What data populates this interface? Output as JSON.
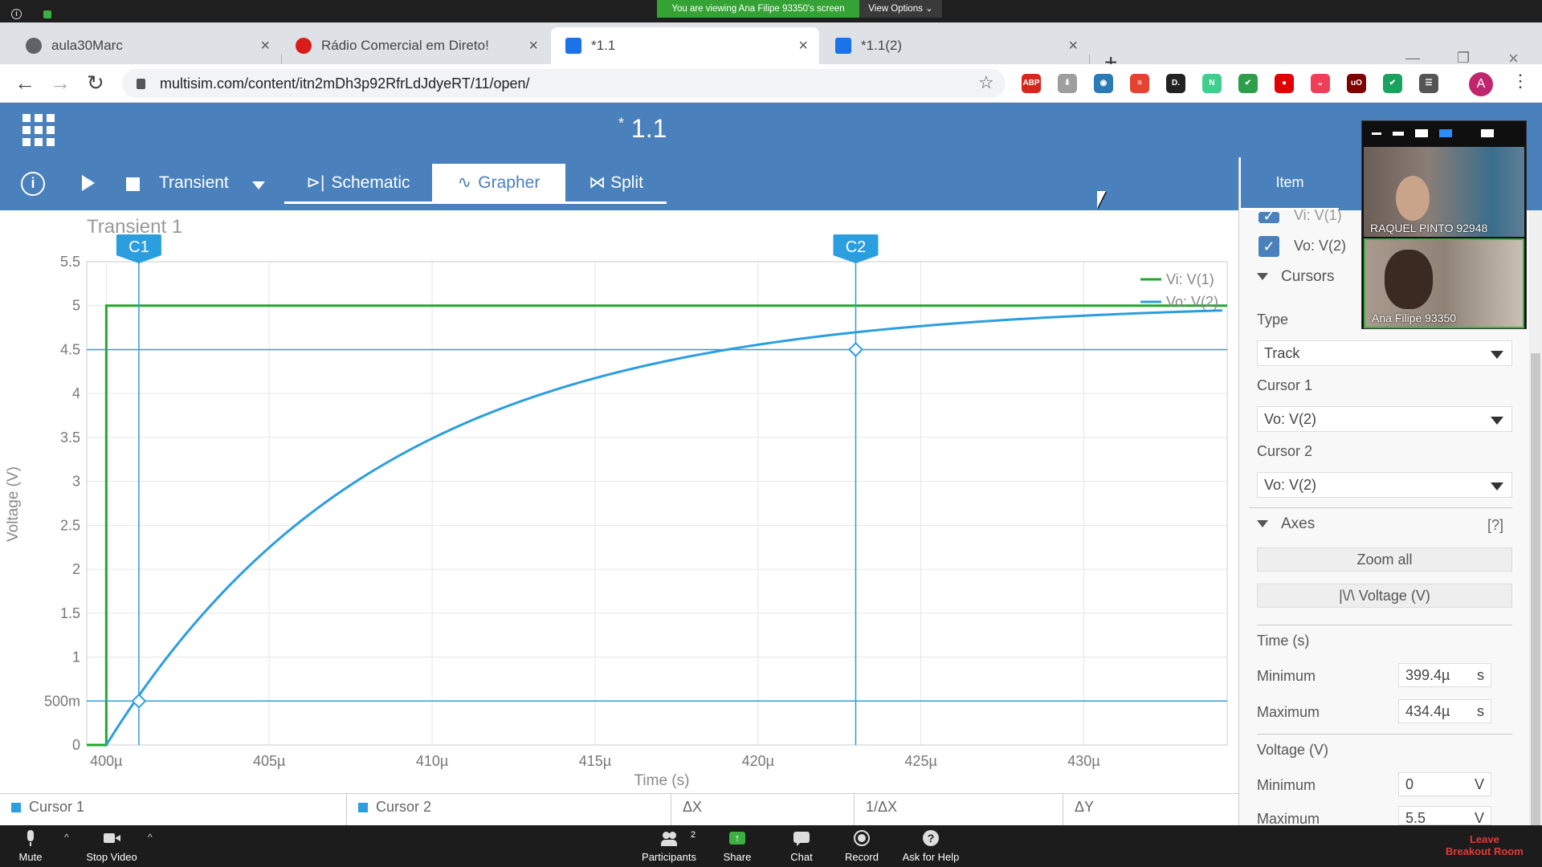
{
  "zoom_banner": {
    "message": "You are viewing Ana Filipe 93350's screen",
    "view_options": "View Options ⌄"
  },
  "browser": {
    "tabs": [
      {
        "title": "aula30Marc",
        "icon_color": "#5f6368"
      },
      {
        "title": "Rádio Comercial em Direto!",
        "icon_color": "#d81b1b"
      },
      {
        "title": "*1.1",
        "icon_color": "#1a73e8"
      },
      {
        "title": "*1.1(2)",
        "icon_color": "#1a73e8"
      }
    ],
    "url": "multisim.com/content/itn2mDh3p92RfrLdJdyeRT/11/open/",
    "profile_initial": "A",
    "extensions": [
      {
        "name": "adblock-plus-icon",
        "label": "ABP",
        "color": "#d7261e"
      },
      {
        "name": "download-icon",
        "label": "⬇",
        "color": "#9e9e9e"
      },
      {
        "name": "eye-extension-icon",
        "label": "◉",
        "color": "#2a7ab8"
      },
      {
        "name": "todoist-icon",
        "label": "≡",
        "color": "#e44332"
      },
      {
        "name": "d-extension-icon",
        "label": "D.",
        "color": "#222222"
      },
      {
        "name": "notion-n-icon",
        "label": "N",
        "color": "#3ecf8e"
      },
      {
        "name": "shield-icon",
        "label": "✔",
        "color": "#2e9e4a"
      },
      {
        "name": "red-extension-icon",
        "label": "●",
        "color": "#e00000"
      },
      {
        "name": "pocket-icon",
        "label": "⌄",
        "color": "#ef3f56"
      },
      {
        "name": "ublock-icon",
        "label": "uO",
        "color": "#800000"
      },
      {
        "name": "green-check-extension-icon",
        "label": "✔",
        "color": "#1aa260"
      },
      {
        "name": "playlist-icon",
        "label": "☰",
        "color": "#555555"
      }
    ]
  },
  "app": {
    "title_prefix": "*",
    "title": "1.1",
    "toolbar": {
      "analysis": "Transient",
      "tab_schematic": "Schematic",
      "tab_grapher": "Grapher",
      "tab_split": "Split"
    }
  },
  "chart_data": {
    "type": "line",
    "title": "Transient 1",
    "xlabel": "Time (s)",
    "ylabel": "Voltage (V)",
    "xlim": [
      399.4,
      434.4
    ],
    "ylim": [
      0,
      5.5
    ],
    "x_ticks": [
      "400µ",
      "405µ",
      "410µ",
      "415µ",
      "420µ",
      "425µ",
      "430µ"
    ],
    "x_tick_values": [
      400,
      405,
      410,
      415,
      420,
      425,
      430
    ],
    "y_ticks": [
      "0",
      "500m",
      "1",
      "1.5",
      "2",
      "2.5",
      "3",
      "3.5",
      "4",
      "4.5",
      "5",
      "5.5"
    ],
    "y_tick_values": [
      0,
      0.5,
      1,
      1.5,
      2,
      2.5,
      3,
      3.5,
      4,
      4.5,
      5,
      5.5
    ],
    "grid": true,
    "legend_position": "top-right",
    "series": [
      {
        "name": "Vi: V(1)",
        "color": "#22a72a",
        "points": [
          [
            399.4,
            0
          ],
          [
            400.0,
            0
          ],
          [
            400.0,
            5
          ],
          [
            434.4,
            5
          ]
        ]
      },
      {
        "name": "Vo: V(2)",
        "color": "#2b9ee0",
        "points": [
          [
            400.0,
            0
          ],
          [
            401.0,
            0.5
          ],
          [
            402.0,
            0.95
          ],
          [
            404.0,
            1.76
          ],
          [
            406.0,
            2.42
          ],
          [
            408.0,
            2.96
          ],
          [
            410.0,
            3.4
          ],
          [
            412.0,
            3.75
          ],
          [
            414.0,
            4.04
          ],
          [
            416.0,
            4.27
          ],
          [
            418.0,
            4.47
          ],
          [
            420.0,
            4.61
          ],
          [
            422.0,
            4.72
          ],
          [
            423.0,
            4.5
          ],
          [
            424.0,
            4.58
          ],
          [
            426.0,
            4.66
          ],
          [
            428.0,
            4.73
          ],
          [
            430.0,
            4.77
          ],
          [
            432.0,
            4.81
          ],
          [
            434.4,
            4.84
          ]
        ]
      }
    ],
    "cursors": [
      {
        "label": "C1",
        "x": 401.0,
        "y": 0.5
      },
      {
        "label": "C2",
        "x": 423.0,
        "y": 4.5
      }
    ]
  },
  "cursor_table": {
    "headers": [
      "Cursor 1",
      "Cursor 2",
      "ΔX",
      "1/ΔX",
      "ΔY"
    ]
  },
  "panel": {
    "item_tab": "Item",
    "trace_partial": "Vi: V(1)",
    "trace_vo": "Vo: V(2)",
    "cursors_section": "Cursors",
    "type_label": "Type",
    "type_value": "Track",
    "cursor1_label": "Cursor 1",
    "cursor1_value": "Vo: V(2)",
    "cursor2_label": "Cursor 2",
    "cursor2_value": "Vo: V(2)",
    "axes_section": "Axes",
    "axes_help": "[?]",
    "zoom_all": "Zoom all",
    "voltage_button": "|\\/\\  Voltage (V)",
    "time_label": "Time (s)",
    "time_min_label": "Minimum",
    "time_min": "399.4µ",
    "time_max_label": "Maximum",
    "time_max": "434.4µ",
    "time_unit": "s",
    "voltage_label": "Voltage (V)",
    "volt_min_label": "Minimum",
    "volt_min": "0",
    "volt_max_label": "Maximum",
    "volt_max": "5.5",
    "volt_unit": "V"
  },
  "video": {
    "participant1": "RAQUEL PINTO 92948",
    "participant2": "Ana Filipe 93350"
  },
  "zoom_bar": {
    "mute": "Mute",
    "stop_video": "Stop Video",
    "participants": "Participants",
    "participants_count": "2",
    "share": "Share",
    "chat": "Chat",
    "record": "Record",
    "ask_help": "Ask for Help",
    "leave_line1": "Leave",
    "leave_line2": "Breakout Room"
  }
}
